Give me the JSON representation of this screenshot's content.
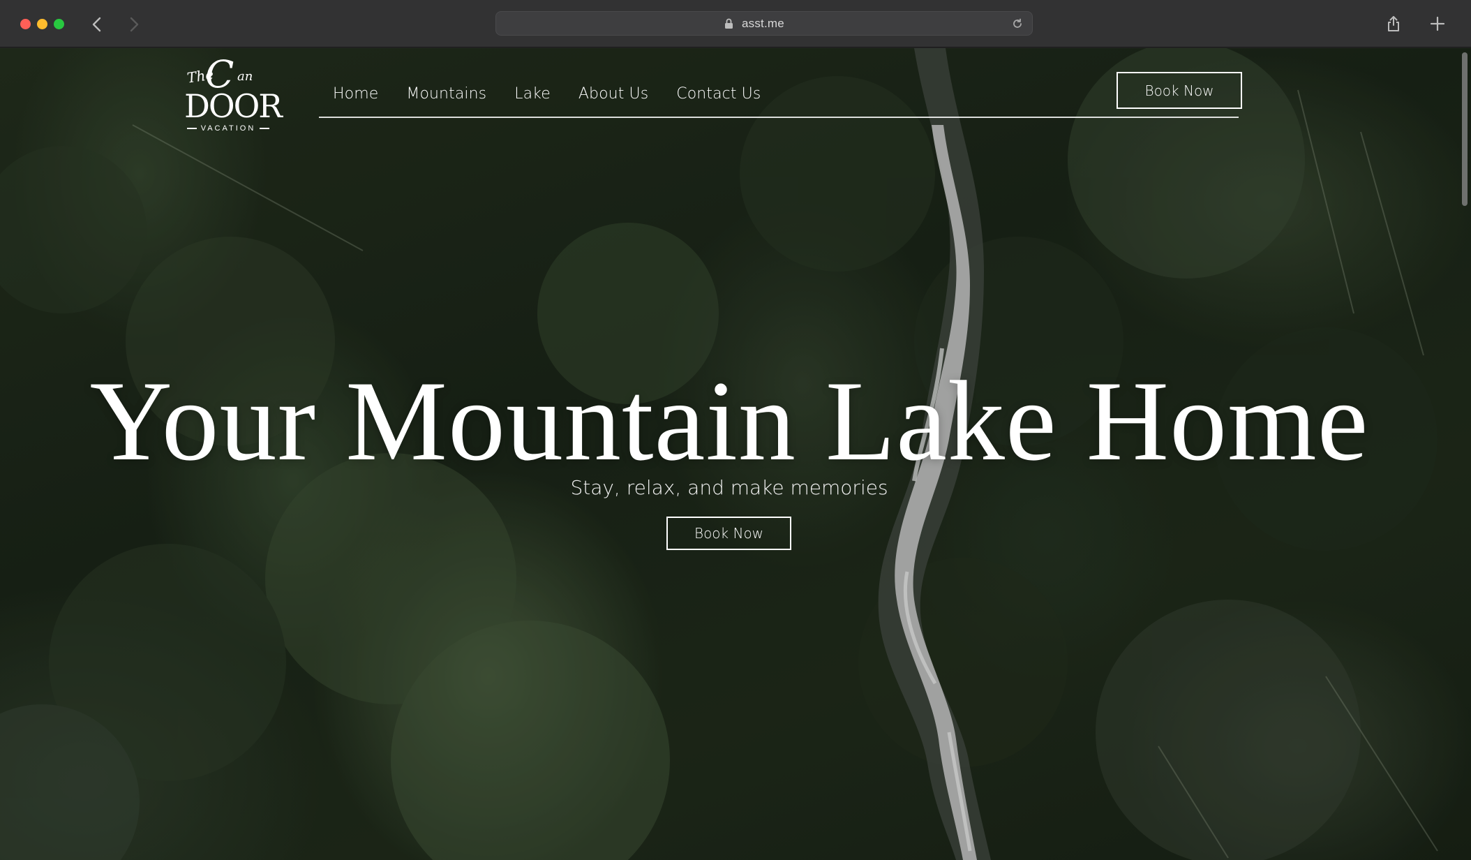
{
  "browser": {
    "url": "asst.me"
  },
  "site": {
    "logo": {
      "the": "The",
      "c": "C",
      "lan": "an",
      "door": "DOOR",
      "vacation": "VACATION"
    },
    "nav": {
      "items": [
        {
          "label": "Home"
        },
        {
          "label": "Mountains"
        },
        {
          "label": "Lake"
        },
        {
          "label": "About Us"
        },
        {
          "label": "Contact Us"
        }
      ],
      "book_label": "Book Now"
    },
    "hero": {
      "title": "Your Mountain Lake Home",
      "subtitle": "Stay, relax, and make memories",
      "book_label": "Book Now"
    }
  },
  "colors": {
    "chrome": "#323233",
    "text": "#ffffff",
    "forest_dark": "#1c2719"
  }
}
